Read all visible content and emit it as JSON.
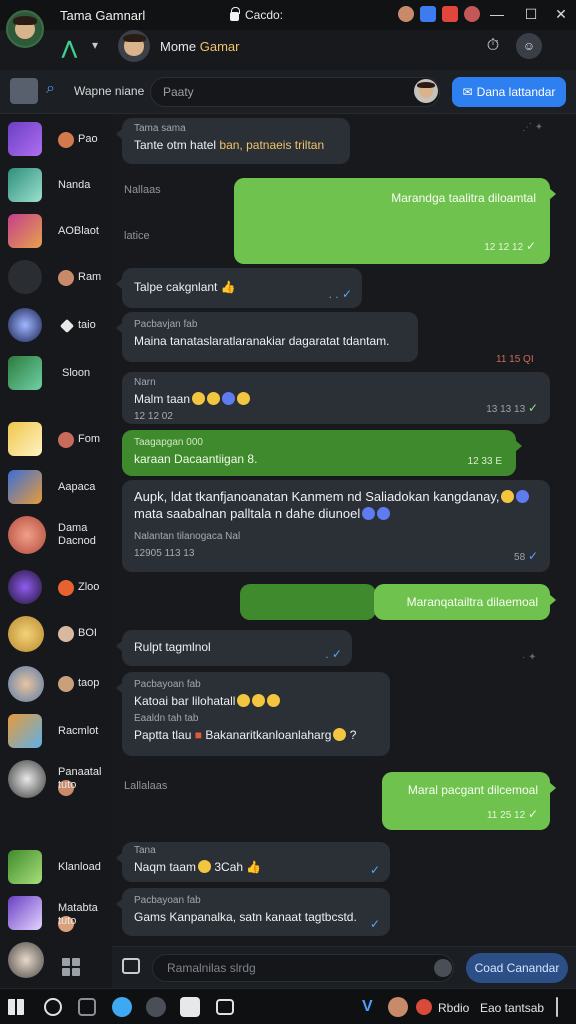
{
  "titlebar": {
    "title": "Tama Gamnarl",
    "center_label": "Cacdo:",
    "controls": {
      "minimize": "—",
      "maximize": "☐",
      "close": "✕"
    }
  },
  "header": {
    "name_part1": "Mome ",
    "name_part2": "Gamar"
  },
  "search": {
    "label": "Wapne niane",
    "placeholder": "Paaty",
    "button_label": "Dana lattandar"
  },
  "sidebar": {
    "items": [
      {
        "label": "Pao",
        "mini": true
      },
      {
        "label": "Nanda",
        "mini": false
      },
      {
        "label": "AOBlaot",
        "mini": false
      },
      {
        "label": "Ram",
        "mini": true
      },
      {
        "label": "taio",
        "mini": true
      },
      {
        "label": "Sloon",
        "mini": false
      },
      {
        "label": "Fom",
        "mini": true
      },
      {
        "label": "Aapaca",
        "mini": false
      },
      {
        "label": "Dama Dacnod",
        "mini": false
      },
      {
        "label": "Zloo",
        "mini": true
      },
      {
        "label": "BOI",
        "mini": true
      },
      {
        "label": "taop",
        "mini": true
      },
      {
        "label": "Racmlot",
        "mini": false
      },
      {
        "label": "Panaatal tuto",
        "mini": true
      },
      {
        "label": "Klanload",
        "mini": false
      },
      {
        "label": "Matabta tuto",
        "mini": true
      }
    ]
  },
  "chat": {
    "system_labels": [
      "Nallaas",
      "latice",
      "Lallalaas"
    ],
    "messages": [
      {
        "sender": "Tama sama",
        "text": "Tante otm hatel",
        "text_accent": "ban, patnaeis triltan"
      },
      {
        "text": "Marandga taalitra diloamtal",
        "time": "12 12 12"
      },
      {
        "text": "Talpe cakgnlant",
        "ticks": ". . ✓"
      },
      {
        "sender": "Pacbavjan fab",
        "text": "Maina tanataslaratlaranakiar dagaratat tdantam.",
        "time": "11 15 QI"
      },
      {
        "sender": "Narn",
        "text": "Malm taan",
        "time": "13 13 13",
        "sub_time": "12 12 02"
      },
      {
        "sender": "Taagapgan 000",
        "text": "karaan Dacaantiigan 8.",
        "time": "12 33 E"
      },
      {
        "text": "Aupk, ldat tkanfjanoanatan Kanmem nd Saliadokan kangdanay,",
        "text2": "mata saabalnan palltala n dahe diunoel",
        "sender": "Nalantan tilanogaca Nal",
        "time": "12905 113 13",
        "time2": "58"
      },
      {
        "text": "Maranqatailtra dilaemoal"
      },
      {
        "text": "Rulpt tagmlnol",
        "ticks": ". ✓"
      },
      {
        "sender": "Pacbayoan fab",
        "text": "Katoai bar lilohatall",
        "sender2": "Eaaldn tah tab",
        "text2": "Paptta tlau",
        "text3": "Bakanaritkanloanlaharg"
      },
      {
        "text": "Maral pacgant dilcemoal",
        "time": "11 25 12"
      },
      {
        "sender": "Tana",
        "text": "Naqm taam",
        "text_b": "3Cah",
        "ticks": "✓"
      },
      {
        "sender": "Pacbayoan fab",
        "text": "Gams Kanpanalka, satn kanaat tagtbcstd.",
        "ticks": "✓"
      }
    ]
  },
  "composer": {
    "placeholder": "Ramalnilas slrdg",
    "send_label": "Coad Canandar"
  },
  "taskbar": {
    "app_label": "Rbdio",
    "app_label2": "Eao tantsab"
  }
}
